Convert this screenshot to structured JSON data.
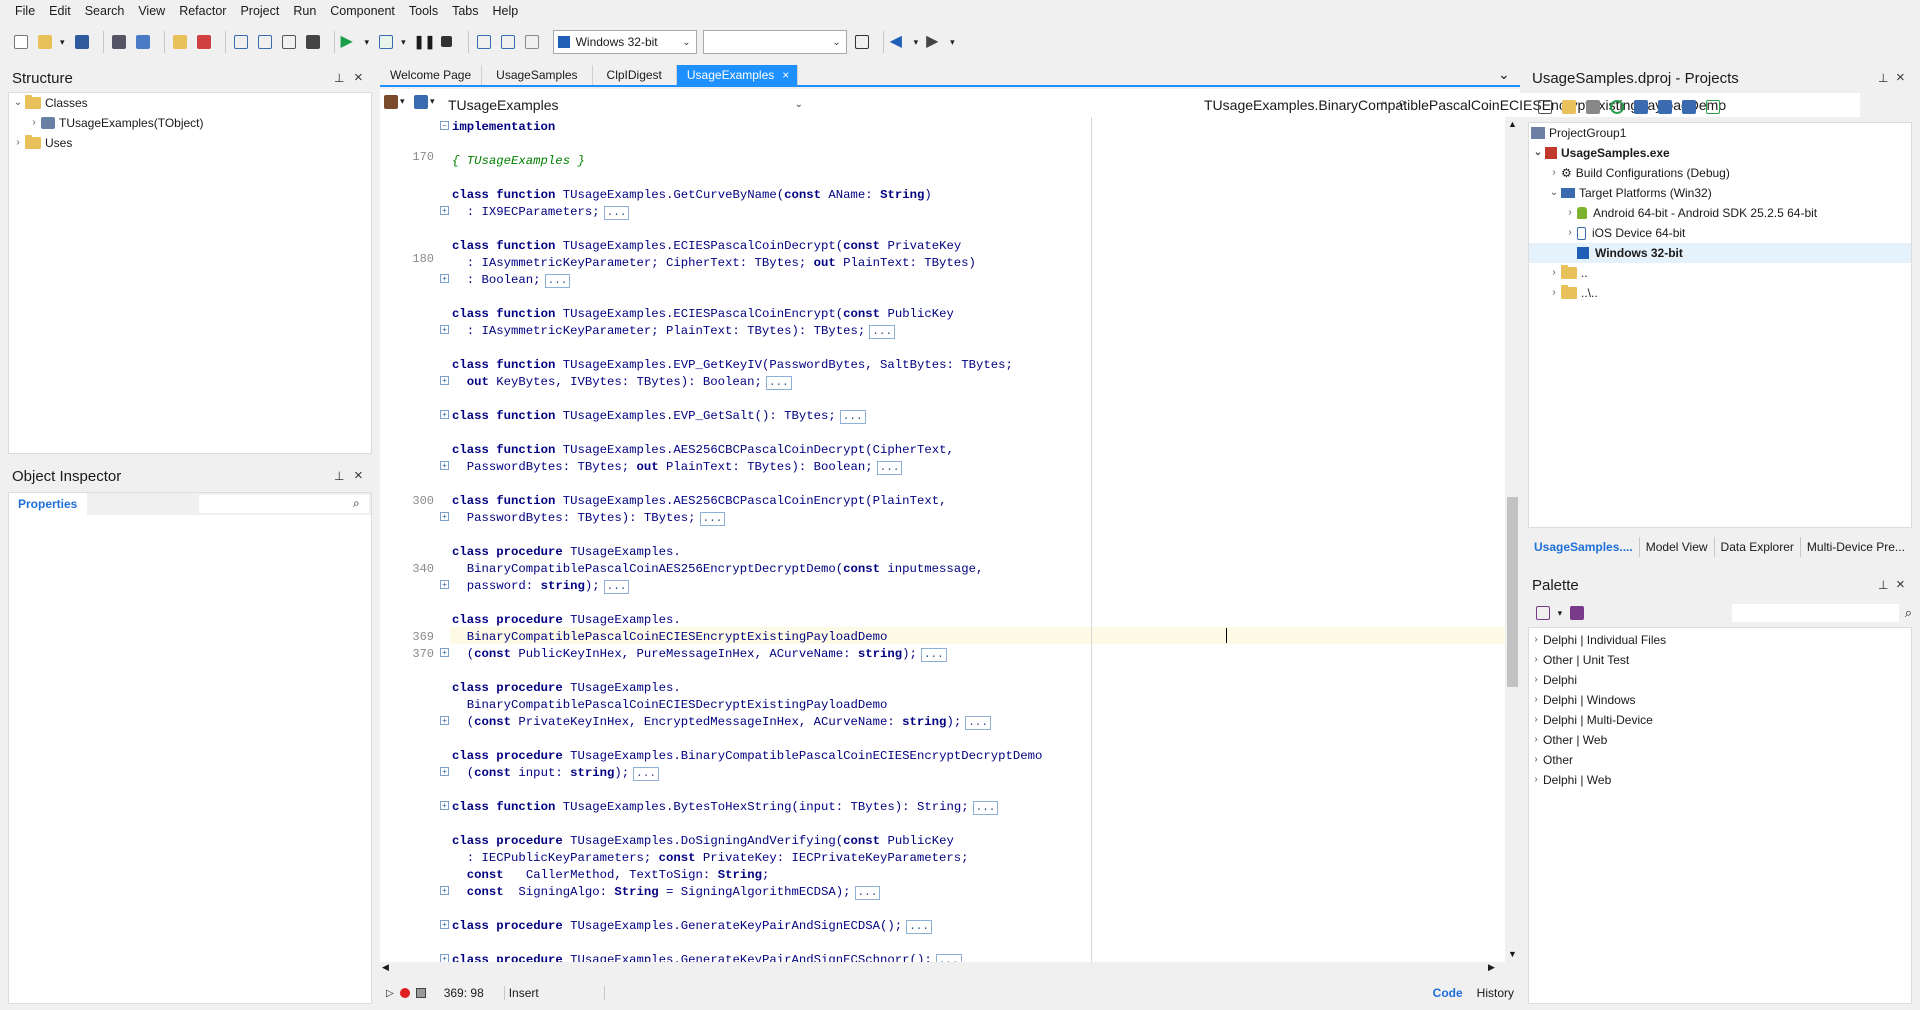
{
  "menu": [
    "File",
    "Edit",
    "Search",
    "View",
    "Refactor",
    "Project",
    "Run",
    "Component",
    "Tools",
    "Tabs",
    "Help"
  ],
  "toolbar": {
    "platform": "Windows 32-bit",
    "config": ""
  },
  "structure": {
    "title": "Structure",
    "items": [
      {
        "label": "Classes"
      },
      {
        "label": "TUsageExamples(TObject)"
      },
      {
        "label": "Uses"
      }
    ]
  },
  "inspector": {
    "title": "Object Inspector",
    "tab": "Properties",
    "search_placeholder": ""
  },
  "tabs": [
    "Welcome Page",
    "UsageSamples",
    "ClpIDigest",
    "UsageExamples"
  ],
  "editor_bar": {
    "class_combo": "TUsageExamples",
    "method_combo": "TUsageExamples.BinaryCompatiblePascalCoinECIESEncryptExistingPayloadDemo"
  },
  "gutter": {
    "l1": "170",
    "l2": "180",
    "l3": "300",
    "l4": "340",
    "l5": "369",
    "l6": "370"
  },
  "code": {
    "c0": "implementation",
    "c1": "{ TUsageExamples }",
    "c2": "TUsageExamples.GetCurveByName(",
    "c2b": " AName: ",
    "c2c": "String",
    "c3": "  : IX9ECParameters;",
    "c4": "TUsageExamples.ECIESPascalCoinDecrypt(",
    "c4b": " PrivateKey",
    "c5": "  : IAsymmetricKeyParameter; CipherText: TBytes; ",
    "c5b": " PlainText: TBytes)",
    "c6": "  : Boolean;",
    "c7": "TUsageExamples.ECIESPascalCoinEncrypt(",
    "c7b": " PublicKey",
    "c8": "  : IAsymmetricKeyParameter; PlainText: TBytes): TBytes;",
    "c9": "TUsageExamples.EVP_GetKeyIV(PasswordBytes, SaltBytes: TBytes;",
    "c10b": " KeyBytes, IVBytes: TBytes): Boolean;",
    "c11": "TUsageExamples.EVP_GetSalt(): TBytes;",
    "c12": "TUsageExamples.AES256CBCPascalCoinDecrypt(CipherText,",
    "c13": "  PasswordBytes: TBytes; ",
    "c13b": " PlainText: TBytes): Boolean;",
    "c14": "TUsageExamples.AES256CBCPascalCoinEncrypt(PlainText,",
    "c15": "  PasswordBytes: TBytes): TBytes;",
    "c16": "TUsageExamples.",
    "c17": "  BinaryCompatiblePascalCoinAES256EncryptDecryptDemo(",
    "c17b": " inputmessage,",
    "c18": "  password: ",
    "c18b": "string",
    "c18c": ");",
    "c19": "TUsageExamples.",
    "c20": "  BinaryCompatiblePascalCoinECIESEncryptExistingPayloadDemo",
    "c21": "  (",
    "c21b": " PublicKeyInHex, PureMessageInHex, ACurveName: ",
    "c22": "TUsageExamples.",
    "c23": "  BinaryCompatiblePascalCoinECIESDecryptExistingPayloadDemo",
    "c24b": " PrivateKeyInHex, EncryptedMessageInHex, ACurveName: ",
    "c25": "TUsageExamples.BinaryCompatiblePascalCoinECIESEncryptDecryptDemo",
    "c26b": " input: ",
    "c27": "TUsageExamples.BytesToHexString(input: TBytes): String;",
    "c28": "TUsageExamples.DoSigningAndVerifying(",
    "c28b": " PublicKey",
    "c29": "  : IECPublicKeyParameters; ",
    "c29b": " PrivateKey: IECPrivateKeyParameters;",
    "c30": "  CallerMethod, TextToSign: ",
    "c30b": "String",
    "c30c": ";",
    "c31": "  SigningAlgo: ",
    "c31b": " = SigningAlgorithmECDSA);",
    "c32": "TUsageExamples.GenerateKeyPairAndSignECDSA();",
    "c33": "TUsageExamples.GenerateKeyPairAndSignECSchnorr();"
  },
  "kw": {
    "class": "class",
    "function": "function",
    "procedure": "procedure",
    "const": "const",
    "out": "out",
    "string": "string",
    "String": "String"
  },
  "ellipsis": "...",
  "status": {
    "position": "369: 98",
    "mode": "Insert",
    "code_tab": "Code",
    "history_tab": "History"
  },
  "projects": {
    "title": "UsageSamples.dproj - Projects",
    "items": [
      {
        "label": "ProjectGroup1"
      },
      {
        "label": "UsageSamples.exe"
      },
      {
        "label": "Build Configurations (Debug)"
      },
      {
        "label": "Target Platforms (Win32)"
      },
      {
        "label": "Android 64-bit - Android SDK 25.2.5 64-bit"
      },
      {
        "label": "iOS Device 64-bit"
      },
      {
        "label": "Windows 32-bit"
      },
      {
        "label": ".."
      },
      {
        "label": "..\\.."
      }
    ],
    "tabs": [
      "UsageSamples....",
      "Model View",
      "Data Explorer",
      "Multi-Device Pre..."
    ]
  },
  "palette": {
    "title": "Palette",
    "items": [
      "Delphi | Individual Files",
      "Other | Unit Test",
      "Delphi",
      "Delphi | Windows",
      "Delphi | Multi-Device",
      "Other | Web",
      "Other",
      "Delphi | Web"
    ]
  },
  "colors": {
    "accent": "#1e90ff",
    "keyword": "#000080",
    "comment": "#008000"
  }
}
